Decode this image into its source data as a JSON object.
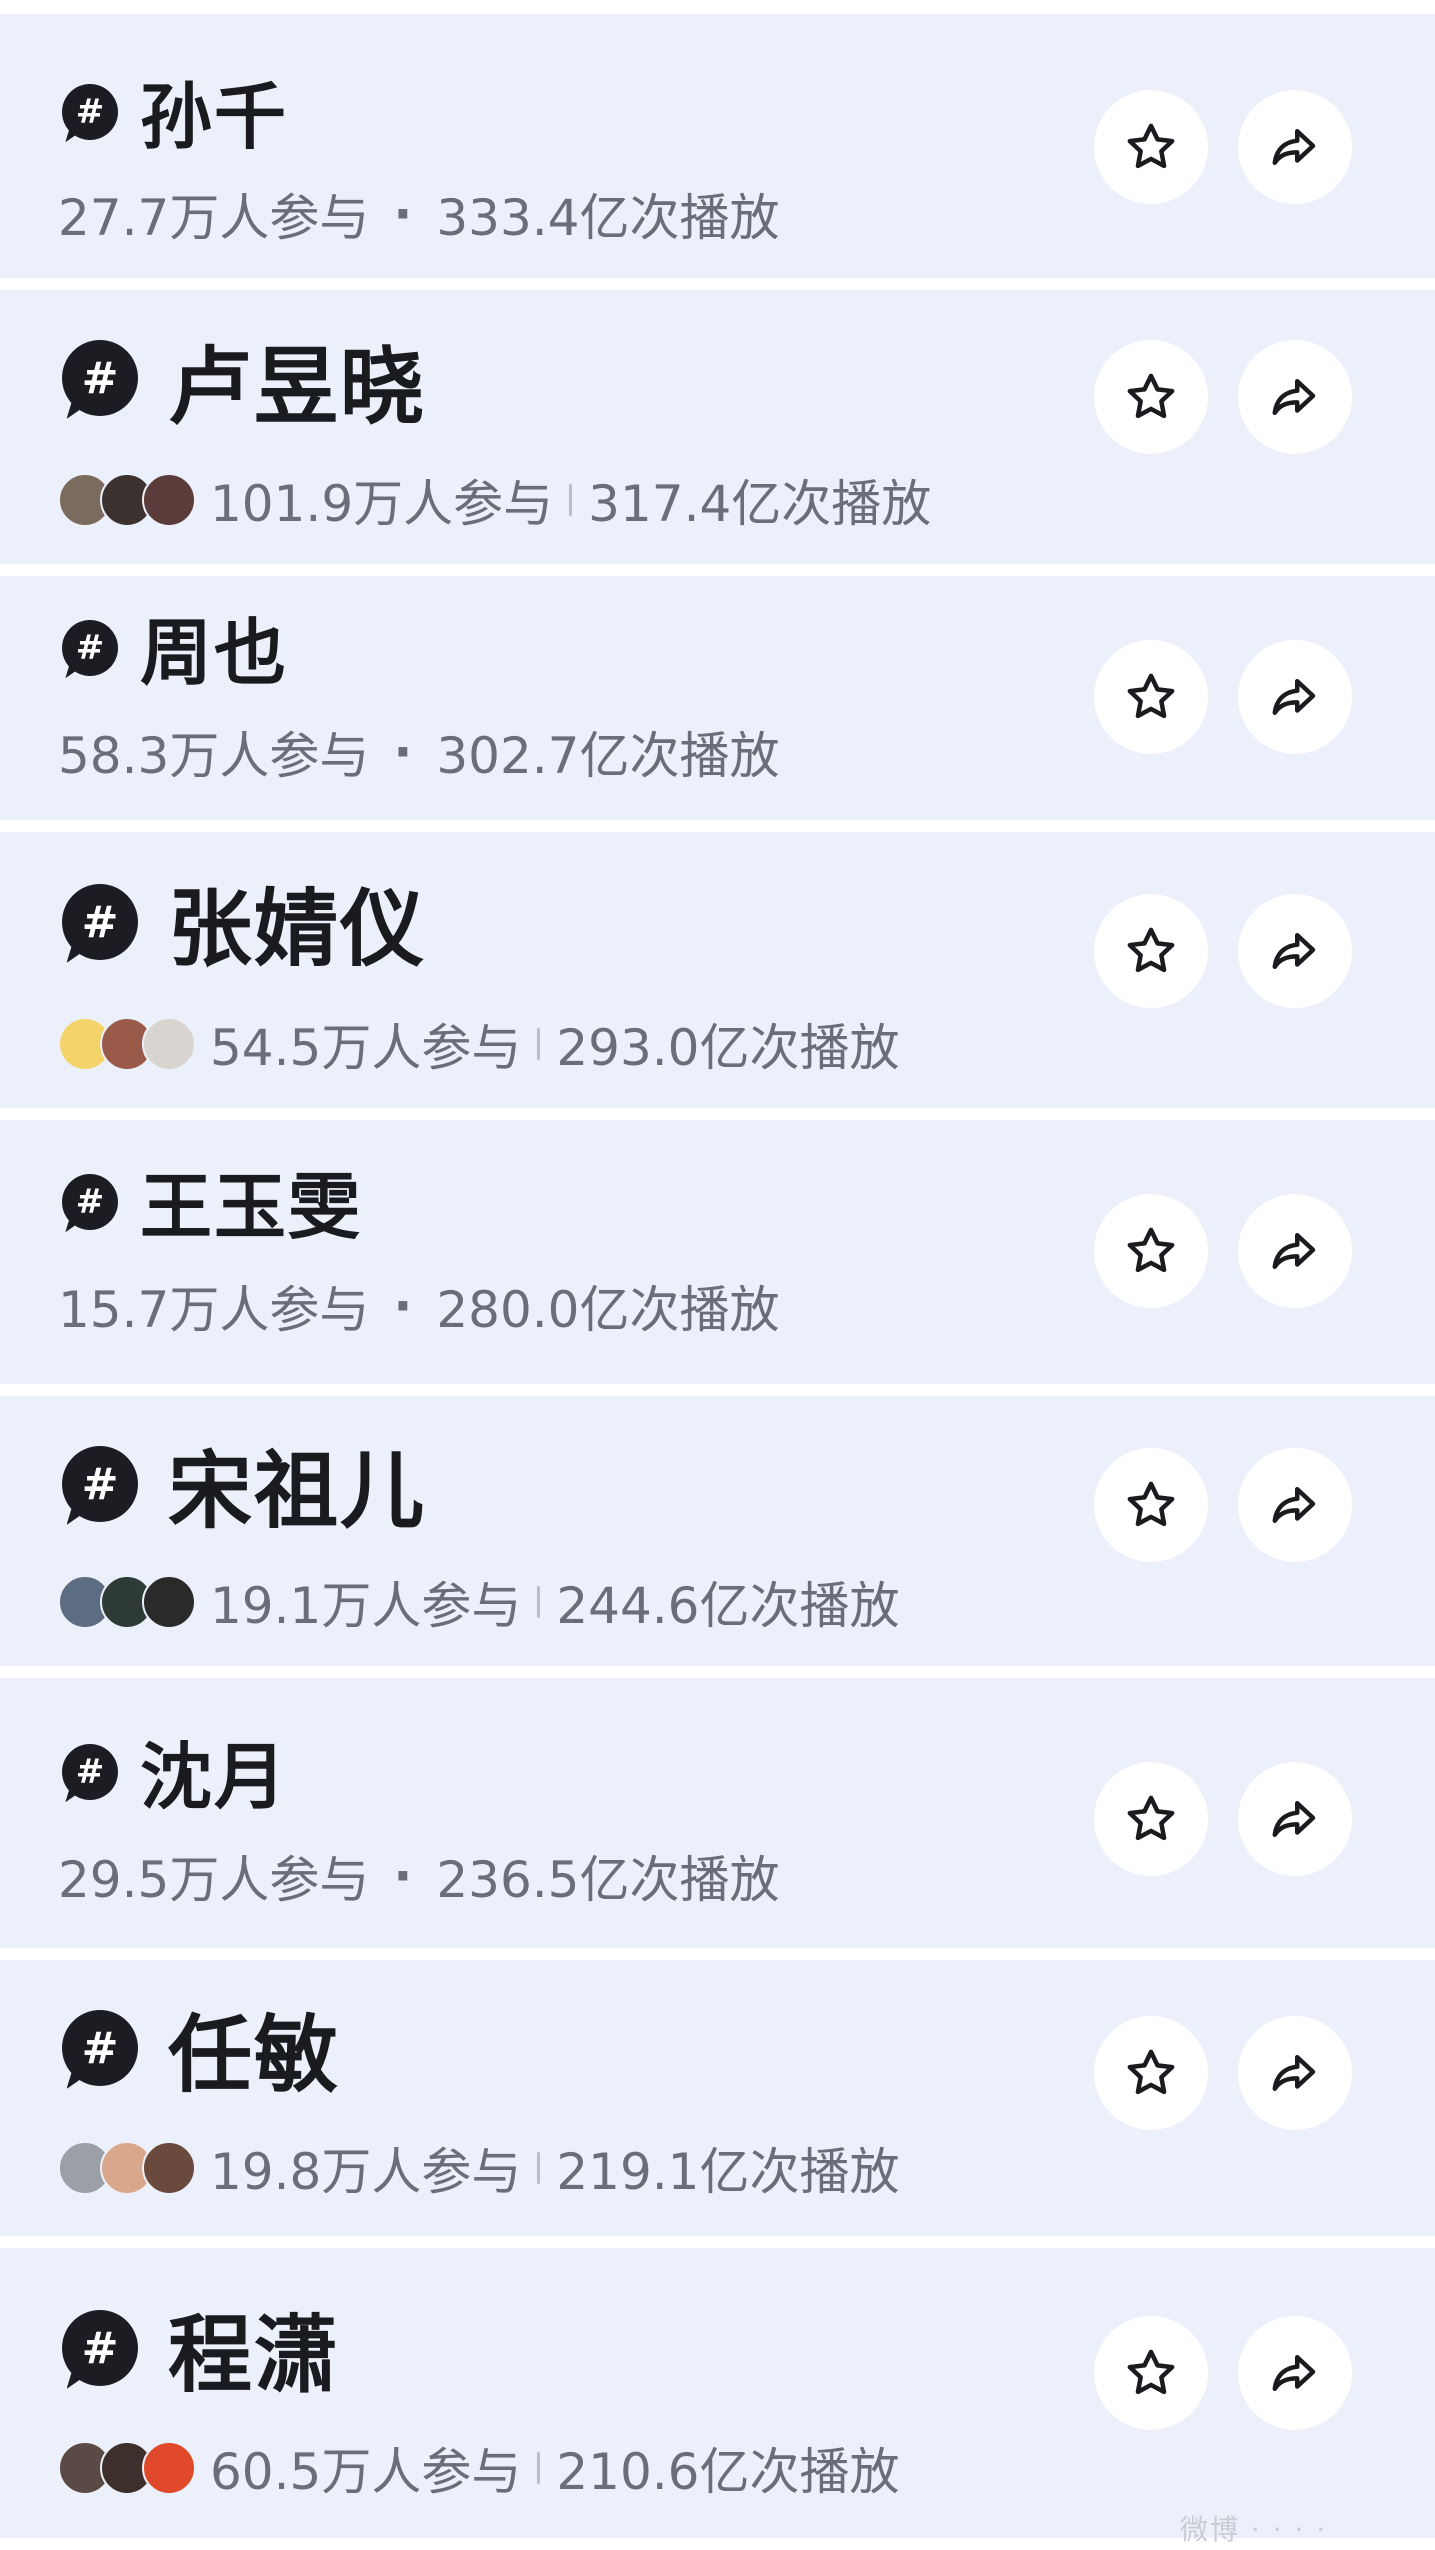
{
  "topics": [
    {
      "title": "孙千",
      "participants": "27.7万人参与",
      "plays": "333.4亿次播放",
      "separator": "·"
    },
    {
      "title": "卢昱晓",
      "participants": "101.9万人参与",
      "plays": "317.4亿次播放",
      "avatars": [
        "#7b6a5e",
        "#3b3230",
        "#5a3d3a"
      ]
    },
    {
      "title": "周也",
      "participants": "58.3万人参与",
      "plays": "302.7亿次播放",
      "separator": "·"
    },
    {
      "title": "张婧仪",
      "participants": "54.5万人参与",
      "plays": "293.0亿次播放",
      "avatars": [
        "#f4d36a",
        "#9a5a4a",
        "#d8d4d0"
      ]
    },
    {
      "title": "王玉雯",
      "participants": "15.7万人参与",
      "plays": "280.0亿次播放",
      "separator": "·"
    },
    {
      "title": "宋祖儿",
      "participants": "19.1万人参与",
      "plays": "244.6亿次播放",
      "avatars": [
        "#5c6c82",
        "#2e3a35",
        "#2a2a2a"
      ]
    },
    {
      "title": "沈月",
      "participants": "29.5万人参与",
      "plays": "236.5亿次播放",
      "separator": "·"
    },
    {
      "title": "任敏",
      "participants": "19.8万人参与",
      "plays": "219.1亿次播放",
      "avatars": [
        "#9aa0a6",
        "#d9a88c",
        "#6b4a3e"
      ]
    },
    {
      "title": "程潇",
      "participants": "60.5万人参与",
      "plays": "210.6亿次播放",
      "avatars": [
        "#5a4a45",
        "#3d2f2c",
        "#e04a2a"
      ]
    }
  ],
  "icons": {
    "topic": "hashtag-bubble-icon",
    "star": "star-outline-icon",
    "share": "share-arrow-icon"
  },
  "tag_symbol": "#",
  "colors": {
    "row_bg": "#ecf0fa",
    "text": "#1a1b1f",
    "meta": "#6a6e78",
    "icon_bg": "#1c1d22"
  },
  "watermark": "微博 · · · ·"
}
